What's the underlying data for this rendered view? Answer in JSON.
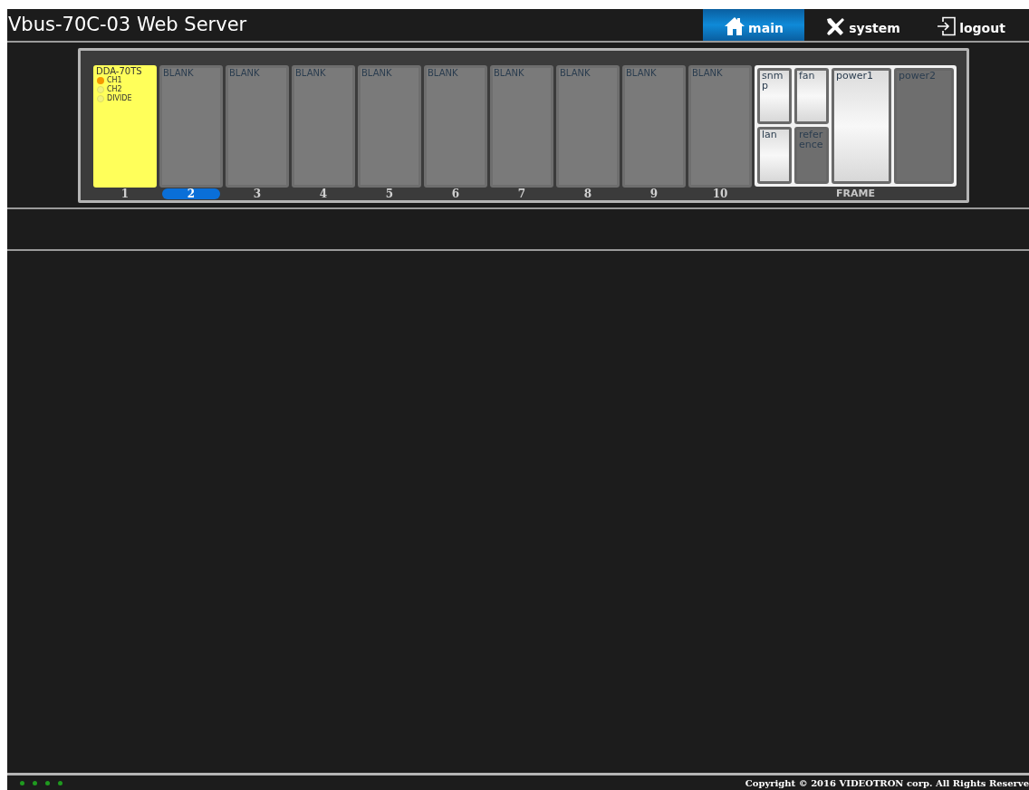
{
  "title": "Vbus-70C-03 Web Server",
  "nav": [
    {
      "label": "main",
      "kind": "home",
      "selected": true
    },
    {
      "label": "system",
      "kind": "tools",
      "selected": false
    },
    {
      "label": "logout",
      "kind": "logout",
      "selected": false
    }
  ],
  "slots": [
    {
      "kind": "card",
      "name": "DDA-70TS",
      "number": "1",
      "selected": false,
      "leds": [
        {
          "label": "CH1",
          "on": true
        },
        {
          "label": "CH2",
          "on": false
        },
        {
          "label": "DIVIDE",
          "on": false
        }
      ]
    },
    {
      "kind": "blank",
      "name": "BLANK",
      "number": "2",
      "selected": true
    },
    {
      "kind": "blank",
      "name": "BLANK",
      "number": "3",
      "selected": false
    },
    {
      "kind": "blank",
      "name": "BLANK",
      "number": "4",
      "selected": false
    },
    {
      "kind": "blank",
      "name": "BLANK",
      "number": "5",
      "selected": false
    },
    {
      "kind": "blank",
      "name": "BLANK",
      "number": "6",
      "selected": false
    },
    {
      "kind": "blank",
      "name": "BLANK",
      "number": "7",
      "selected": false
    },
    {
      "kind": "blank",
      "name": "BLANK",
      "number": "8",
      "selected": false
    },
    {
      "kind": "blank",
      "name": "BLANK",
      "number": "9",
      "selected": false
    },
    {
      "kind": "blank",
      "name": "BLANK",
      "number": "10",
      "selected": false
    }
  ],
  "frame": {
    "label": "FRAME",
    "modules": [
      {
        "label": "snm p",
        "on": true
      },
      {
        "label": "lan",
        "on": true
      },
      {
        "label": "fan",
        "on": true
      },
      {
        "label": "refer ence",
        "on": false
      },
      {
        "label": "power1",
        "on": true
      },
      {
        "label": "power2",
        "on": false
      }
    ]
  },
  "footer": {
    "copyright": "Copyright © 2016 VIDEOTRON corp. All Rights Reserve"
  }
}
